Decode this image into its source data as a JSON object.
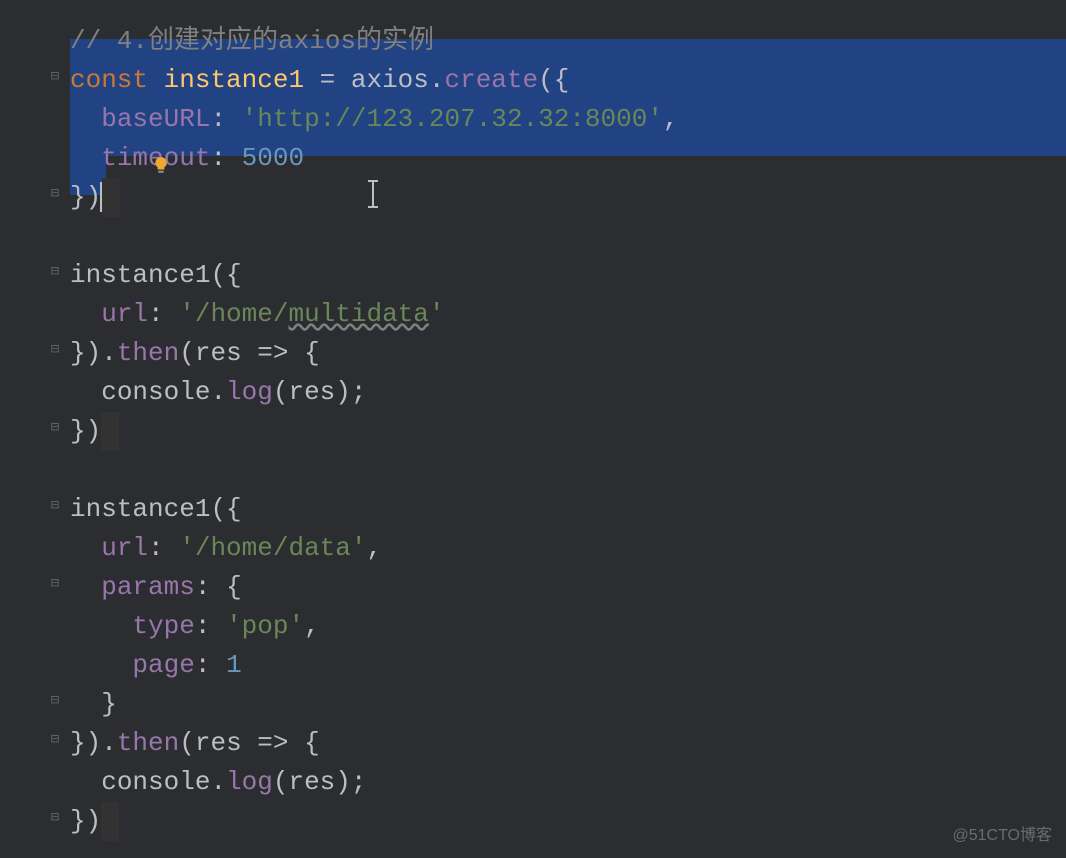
{
  "code": {
    "comment": "// 4.创建对应的axios的实例",
    "const": "const",
    "instance1": "instance1",
    "equals": " = ",
    "axios": "axios",
    "dot": ".",
    "create": "create",
    "open_paren_brace": "({",
    "baseURL_key": "baseURL",
    "colon_space": ": ",
    "baseURL_val": "'http://123.207.32.32:8000'",
    "comma": ",",
    "timeout_key": "timeout",
    "timeout_val": "5000",
    "close_brace_paren": "})",
    "url_key": "url",
    "url_val1": "'/home/",
    "multidata": "multidata",
    "url_val1_end": "'",
    "url_val2": "'/home/data'",
    "params_key": "params",
    "open_brace": "{",
    "type_key": "type",
    "type_val": "'pop'",
    "page_key": "page",
    "page_val": "1",
    "close_brace": "}",
    "then": "then",
    "res": "res",
    "arrow": " => ",
    "console": "console",
    "log": "log",
    "semicolon": ";",
    "space2": "  ",
    "space4": "    ",
    "space6": "      "
  },
  "watermark": "@51CTO博客"
}
